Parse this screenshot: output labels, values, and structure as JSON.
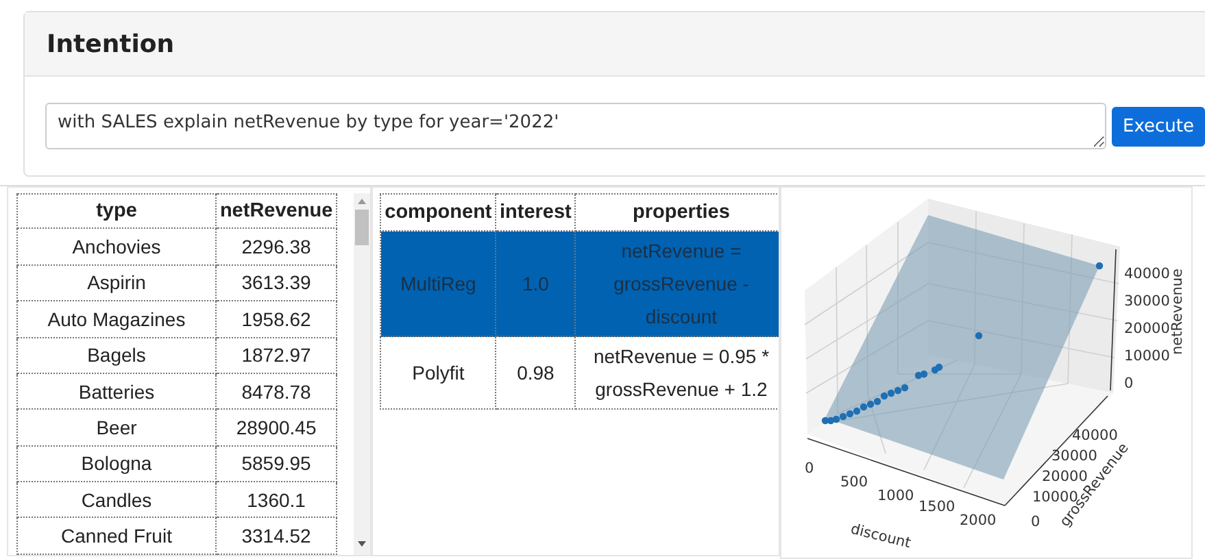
{
  "intention": {
    "title": "Intention",
    "query": "with SALES explain netRevenue by type for year='2022'",
    "button": "Execute"
  },
  "data_table": {
    "columns": [
      "type",
      "netRevenue"
    ],
    "rows": [
      {
        "cells": [
          "Anchovies",
          "2296.38"
        ]
      },
      {
        "cells": [
          "Aspirin",
          "3613.39"
        ]
      },
      {
        "cells": [
          "Auto Magazines",
          "1958.62"
        ]
      },
      {
        "cells": [
          "Bagels",
          "1872.97"
        ]
      },
      {
        "cells": [
          "Batteries",
          "8478.78"
        ]
      },
      {
        "cells": [
          "Beer",
          "28900.45"
        ]
      },
      {
        "cells": [
          "Bologna",
          "5859.95"
        ]
      },
      {
        "cells": [
          "Candles",
          "1360.1"
        ]
      },
      {
        "cells": [
          "Canned Fruit",
          "3314.52"
        ]
      }
    ]
  },
  "components_table": {
    "columns": [
      "component",
      "interest",
      "properties"
    ],
    "rows": [
      {
        "cells": [
          "MultiReg",
          "1.0",
          "netRevenue = grossRevenue - discount"
        ],
        "selected": true
      },
      {
        "cells": [
          "Polyfit",
          "0.98",
          "netRevenue = 0.95 * grossRevenue + 1.2"
        ],
        "selected": false
      }
    ]
  },
  "plot": {
    "x_label": "discount",
    "y_label": "grossRevenue",
    "z_label": "netRevenue",
    "x_ticks": [
      "0",
      "500",
      "1000",
      "1500",
      "2000"
    ],
    "y_ticks": [
      "40000",
      "30000",
      "20000",
      "10000",
      "0"
    ],
    "z_ticks": [
      "40000",
      "30000",
      "20000",
      "10000",
      "0"
    ]
  }
}
